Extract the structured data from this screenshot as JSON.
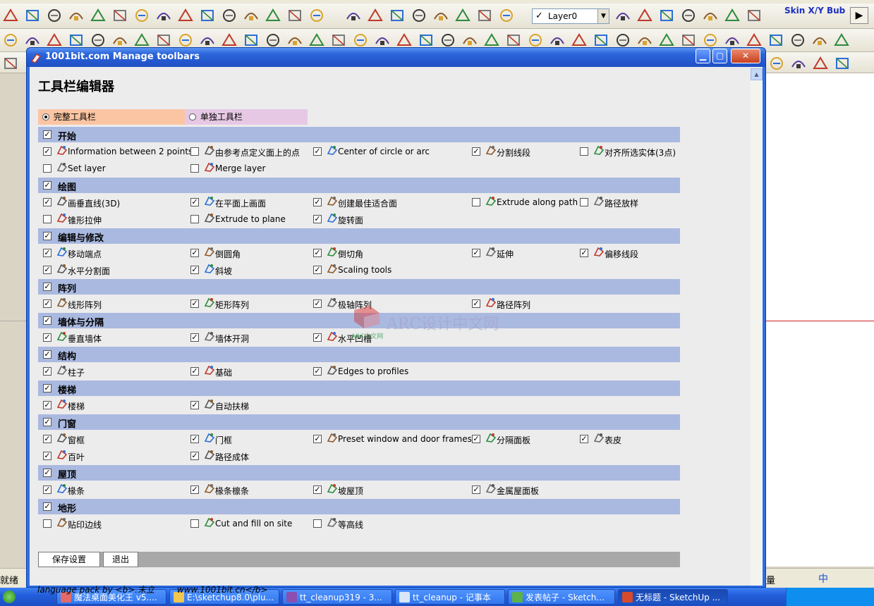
{
  "app": {
    "layer_name": "Layer0",
    "skin_label": "Skin X/Y Bub",
    "status_left": "就绪",
    "status_right": "量",
    "ime_label": "中"
  },
  "window": {
    "title": "1001bit.com Manage toolbars",
    "heading": "工具栏编辑器",
    "tabs": [
      {
        "label": "完整工具栏",
        "selected": true
      },
      {
        "label": "单独工具栏",
        "selected": false
      }
    ],
    "save_label": "保存设置",
    "exit_label": "退出",
    "footer_text": "language pack by <b>.末立",
    "footer_url": "www.1001bit.cn</b>",
    "watermark_text": "ARC设计中文网",
    "watermark_sub": "ARC中文网",
    "categories": [
      {
        "label": "开始",
        "checked": true,
        "items": [
          {
            "label": "Information between 2 points",
            "checked": true
          },
          {
            "label": "由参考点定义面上的点",
            "checked": false
          },
          {
            "label": "Center of circle or arc",
            "checked": true
          },
          {
            "label": "分割线段",
            "checked": true
          },
          {
            "label": "对齐所选实体(3点)",
            "checked": false
          },
          {
            "label": "Set layer",
            "checked": false
          },
          {
            "label": "Merge layer",
            "checked": false
          }
        ]
      },
      {
        "label": "绘图",
        "checked": true,
        "items": [
          {
            "label": "画垂直线(3D)",
            "checked": true
          },
          {
            "label": "在平面上画面",
            "checked": true
          },
          {
            "label": "创建最佳适合面",
            "checked": true
          },
          {
            "label": "Extrude along path",
            "checked": false
          },
          {
            "label": "路径放样",
            "checked": false
          },
          {
            "label": "锥形拉伸",
            "checked": false
          },
          {
            "label": "Extrude to plane",
            "checked": false
          },
          {
            "label": "旋转面",
            "checked": true
          }
        ]
      },
      {
        "label": "编辑与修改",
        "checked": true,
        "items": [
          {
            "label": "移动端点",
            "checked": true
          },
          {
            "label": "倒圆角",
            "checked": true
          },
          {
            "label": "倒切角",
            "checked": true
          },
          {
            "label": "延伸",
            "checked": true
          },
          {
            "label": "偏移线段",
            "checked": true
          },
          {
            "label": "水平分割面",
            "checked": true
          },
          {
            "label": "斜坡",
            "checked": true
          },
          {
            "label": "Scaling tools",
            "checked": true
          }
        ]
      },
      {
        "label": "阵列",
        "checked": true,
        "items": [
          {
            "label": "线形阵列",
            "checked": true
          },
          {
            "label": "矩形阵列",
            "checked": true
          },
          {
            "label": "极轴阵列",
            "checked": true
          },
          {
            "label": "路径阵列",
            "checked": true
          }
        ]
      },
      {
        "label": "墙体与分隔",
        "checked": true,
        "items": [
          {
            "label": "垂直墙体",
            "checked": true
          },
          {
            "label": "墙体开洞",
            "checked": true
          },
          {
            "label": "水平凹槽",
            "checked": true
          }
        ]
      },
      {
        "label": "结构",
        "checked": true,
        "items": [
          {
            "label": "柱子",
            "checked": true
          },
          {
            "label": "基础",
            "checked": true
          },
          {
            "label": "Edges to profiles",
            "checked": true
          }
        ]
      },
      {
        "label": "楼梯",
        "checked": true,
        "items": [
          {
            "label": "楼梯",
            "checked": true
          },
          {
            "label": "自动扶梯",
            "checked": true
          }
        ]
      },
      {
        "label": "门窗",
        "checked": true,
        "items": [
          {
            "label": "窗框",
            "checked": true
          },
          {
            "label": "门框",
            "checked": true
          },
          {
            "label": "Preset window and door frames",
            "checked": true
          },
          {
            "label": "分隔面板",
            "checked": true
          },
          {
            "label": "表皮",
            "checked": true
          },
          {
            "label": "百叶",
            "checked": true
          },
          {
            "label": "路径成体",
            "checked": true
          }
        ]
      },
      {
        "label": "屋顶",
        "checked": true,
        "items": [
          {
            "label": "椽条",
            "checked": true
          },
          {
            "label": "椽条檩条",
            "checked": true
          },
          {
            "label": "坡屋顶",
            "checked": true
          },
          {
            "label": "金属屋面板",
            "checked": true
          }
        ]
      },
      {
        "label": "地形",
        "checked": true,
        "items": [
          {
            "label": "贴印边线",
            "checked": false
          },
          {
            "label": "Cut and fill on site",
            "checked": false
          },
          {
            "label": "等高线",
            "checked": false
          }
        ]
      }
    ]
  },
  "taskbar": {
    "tasks": [
      {
        "label": "魔法桌面美化王 v5....",
        "icon_color": "#e26a6a"
      },
      {
        "label": "E:\\sketchup8.0\\plu...",
        "icon_color": "#f3c74f"
      },
      {
        "label": "tt_cleanup319 - 3...",
        "icon_color": "#8a4fb0"
      },
      {
        "label": "tt_cleanup - 记事本",
        "icon_color": "#d9e6f5"
      },
      {
        "label": "发表帖子 - Sketch...",
        "icon_color": "#5db24a"
      },
      {
        "label": "无标题 - SketchUp ...",
        "icon_color": "#d94a2a",
        "active": true
      }
    ]
  },
  "colors": {
    "tab_full_bg": "#fbc5a3",
    "tab_single_bg": "#e6c8e4",
    "category_bar_bg": "#aab9e0",
    "titlebar_blue": "#2458cf",
    "taskbar_blue": "#245edb"
  }
}
